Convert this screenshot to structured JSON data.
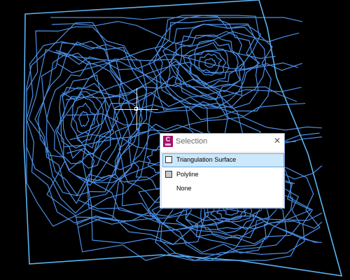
{
  "dialog": {
    "title": "Selection",
    "close_symbol": "✕",
    "app_icon_letter": "C",
    "options": [
      {
        "label": "Triangulation Surface",
        "swatch": "#ffffff",
        "selected": true
      },
      {
        "label": "Polyline",
        "swatch": "#c9c9c9",
        "selected": false
      },
      {
        "label": "None",
        "swatch": null,
        "selected": false
      }
    ]
  },
  "colors": {
    "background": "#000000",
    "contours": "#4a8fe6",
    "boundary": "#5ab4f2",
    "selection_highlight": "#cde8fb",
    "app_icon": "#a4126c"
  },
  "icons": [
    "app-icon",
    "close-icon",
    "crosshair-cursor"
  ]
}
